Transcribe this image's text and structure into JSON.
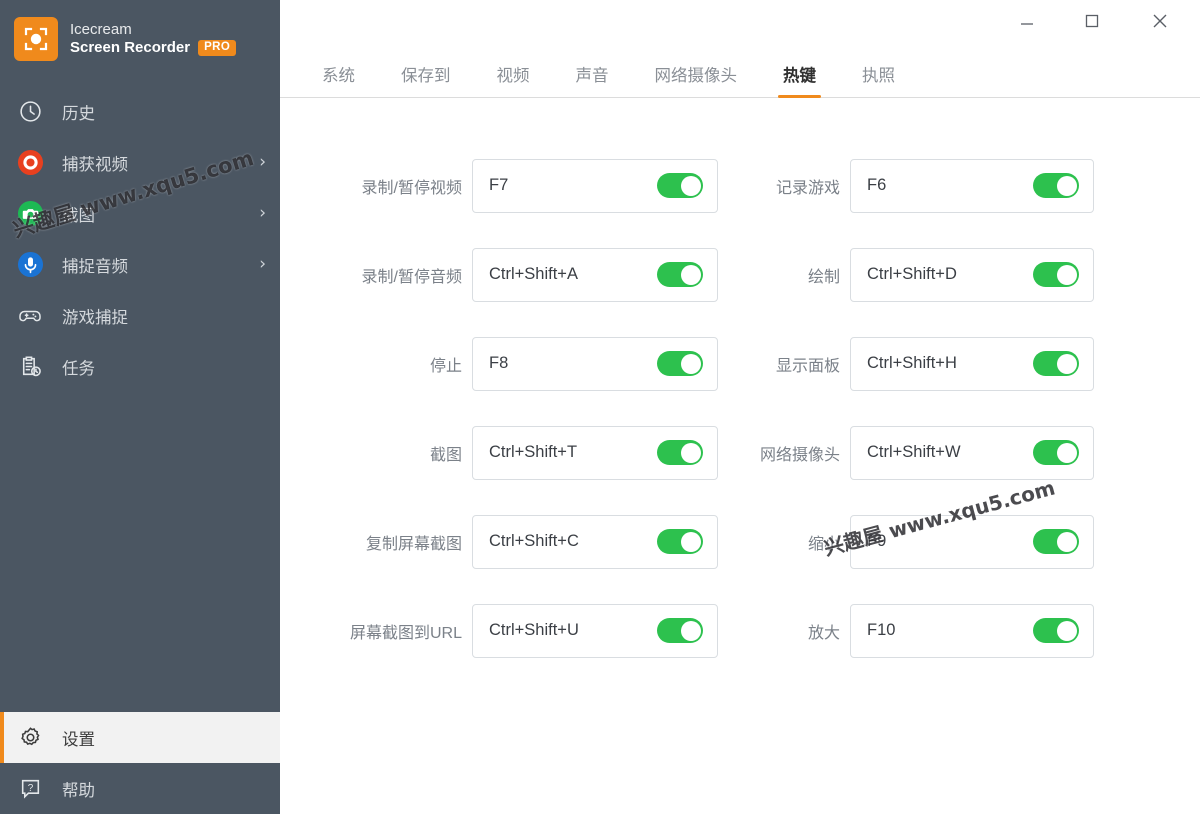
{
  "brand": {
    "line1": "Icecream",
    "line2": "Screen Recorder",
    "badge": "PRO",
    "logo_icon": "record-frame-icon"
  },
  "sidebar": {
    "items": [
      {
        "label": "历史",
        "icon": "clock-icon",
        "chevron": "",
        "selected": false
      },
      {
        "label": "捕获视频",
        "icon": "record-icon",
        "chevron": "›",
        "selected": false
      },
      {
        "label": "截图",
        "icon": "camera-icon",
        "chevron": "›",
        "selected": false
      },
      {
        "label": "捕捉音频",
        "icon": "microphone-icon",
        "chevron": "›",
        "selected": false
      },
      {
        "label": "游戏捕捉",
        "icon": "gamepad-icon",
        "chevron": "",
        "selected": false
      },
      {
        "label": "任务",
        "icon": "clipboard-clock-icon",
        "chevron": "",
        "selected": false
      }
    ],
    "bottom_items": [
      {
        "label": "设置",
        "icon": "gear-icon",
        "selected": true
      },
      {
        "label": "帮助",
        "icon": "help-question-icon",
        "selected": false
      }
    ]
  },
  "titlebar": {
    "minimize": "minimize-icon",
    "maximize": "maximize-icon",
    "close": "close-icon"
  },
  "tabs": [
    {
      "label": "系统",
      "active": false
    },
    {
      "label": "保存到",
      "active": false
    },
    {
      "label": "视频",
      "active": false
    },
    {
      "label": "声音",
      "active": false
    },
    {
      "label": "网络摄像头",
      "active": false
    },
    {
      "label": "热键",
      "active": true
    },
    {
      "label": "执照",
      "active": false
    }
  ],
  "hotkeys": {
    "left_column": [
      {
        "label": "录制/暂停视频",
        "value": "F7",
        "enabled": true
      },
      {
        "label": "录制/暂停音频",
        "value": "Ctrl+Shift+A",
        "enabled": true
      },
      {
        "label": "停止",
        "value": "F8",
        "enabled": true
      },
      {
        "label": "截图",
        "value": "Ctrl+Shift+T",
        "enabled": true
      },
      {
        "label": "复制屏幕截图",
        "value": "Ctrl+Shift+C",
        "enabled": true
      },
      {
        "label": "屏幕截图到URL",
        "value": "Ctrl+Shift+U",
        "enabled": true
      }
    ],
    "right_column": [
      {
        "label": "记录游戏",
        "value": "F6",
        "enabled": true
      },
      {
        "label": "绘制",
        "value": "Ctrl+Shift+D",
        "enabled": true
      },
      {
        "label": "显示面板",
        "value": "Ctrl+Shift+H",
        "enabled": true
      },
      {
        "label": "网络摄像头",
        "value": "Ctrl+Shift+W",
        "enabled": true
      },
      {
        "label": "缩小",
        "value": "F9",
        "enabled": true
      },
      {
        "label": "放大",
        "value": "F10",
        "enabled": true
      }
    ]
  },
  "watermarks": [
    {
      "text": "兴趣屋 www.xqu5.com"
    },
    {
      "text": "兴趣屋 www.xqu5.com"
    }
  ],
  "colors": {
    "sidebar_bg": "#4b5662",
    "accent_orange": "#f08a1c",
    "toggle_on_green": "#2dc14e",
    "record_red": "#e8401f",
    "camera_green": "#1db954",
    "mic_blue": "#1a73d4"
  }
}
